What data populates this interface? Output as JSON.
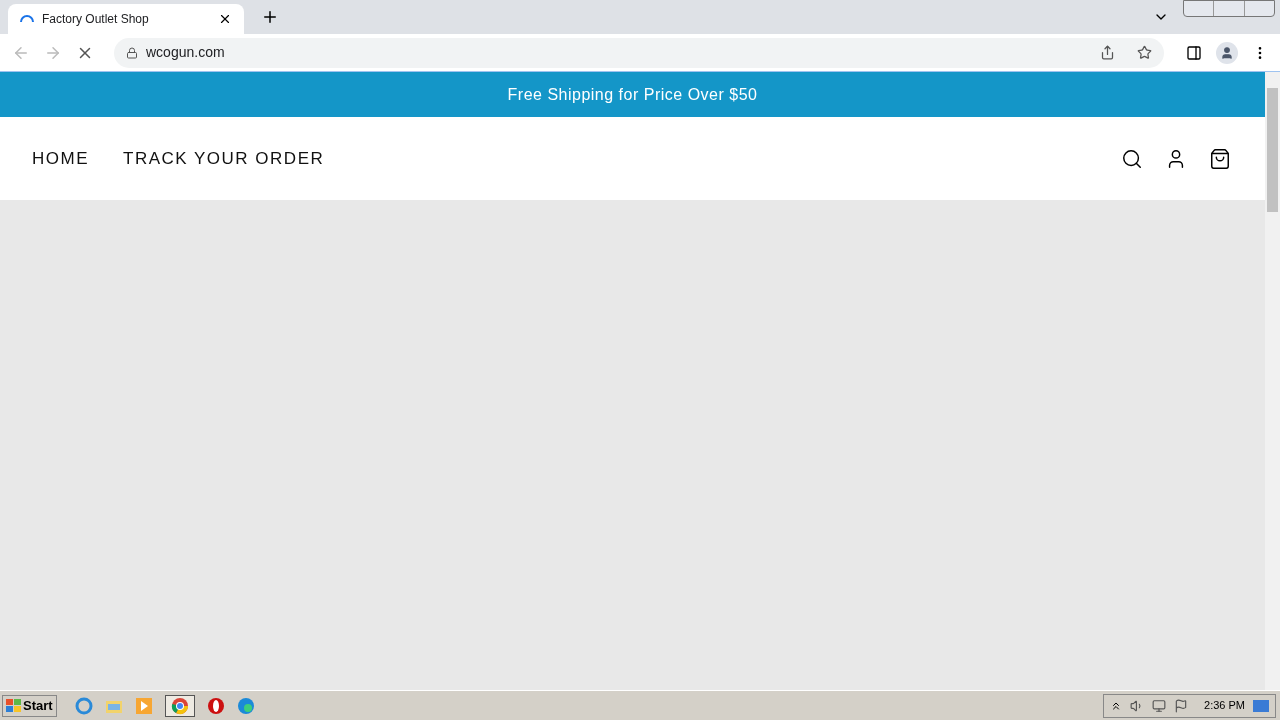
{
  "browser": {
    "tab_title": "Factory Outlet Shop",
    "url": "wcogun.com"
  },
  "page": {
    "banner": "Free Shipping for Price Over $50",
    "nav": [
      {
        "label": "HOME"
      },
      {
        "label": "TRACK YOUR ORDER"
      }
    ]
  },
  "taskbar": {
    "start": "Start",
    "clock": "2:36 PM"
  }
}
